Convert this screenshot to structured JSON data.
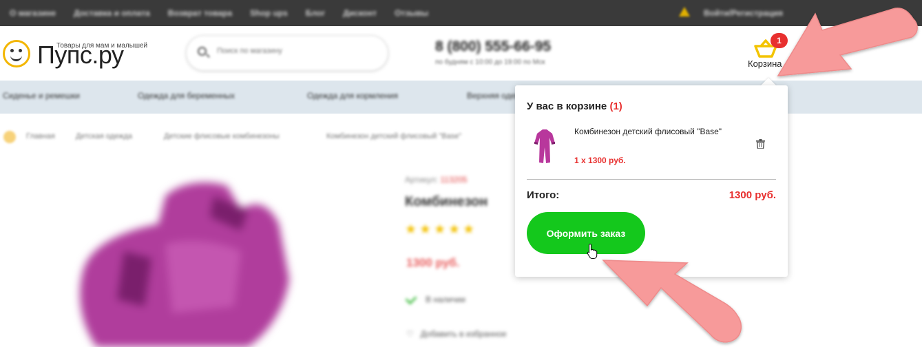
{
  "topbar": {
    "nav": [
      "О магазине",
      "Доставка и оплата",
      "Возврат товара",
      "Shop ups",
      "Блог",
      "Дисконт",
      "Отзывы"
    ],
    "login": "Войти/Регистрация"
  },
  "header": {
    "logo_name": "Пупс.ру",
    "logo_tagline": "Товары для мам и малышей",
    "search_placeholder": "Поиск по магазину",
    "phone": "8 (800) 555-66-95",
    "phone_hours": "по будням с 10:00 до 19:00 по Мск",
    "cart_label": "Корзина",
    "cart_count": "1"
  },
  "categories": [
    "Сиденье и ремешки",
    "Одежда для беременных",
    "Одежда для кормления",
    "Верхняя одежда"
  ],
  "breadcrumbs": [
    "Главная",
    "Детская одежда",
    "Детские флисовые комбинезоны",
    "Комбинезон детский флисовый \"Base\""
  ],
  "product": {
    "article_label": "Артикул:",
    "article_value": "113205",
    "title": "Комбинезон",
    "stars": "★★★★★",
    "price": "1300 руб.",
    "stock": "В наличии",
    "favorite": "Добавить в избранное"
  },
  "cart_popup": {
    "title": "У вас в корзине",
    "count": "(1)",
    "item_name": "Комбинезон детский флисовый \"Base\"",
    "item_qty_price": "1 x 1300 руб.",
    "total_label": "Итого:",
    "total_value": "1300 руб.",
    "checkout_label": "Оформить заказ"
  },
  "colors": {
    "topbar": "#3a3a3a",
    "accent_red": "#e8302f",
    "checkout_green": "#14c81c",
    "logo_yellow": "#f3b600",
    "category_bar": "#dde6ed",
    "annotation_arrow": "#f79a9a"
  },
  "icons": [
    "smiley-logo-icon",
    "search-icon",
    "warning-icon",
    "basket-icon",
    "trash-icon",
    "pointer-cursor-icon",
    "checkmark-icon"
  ]
}
